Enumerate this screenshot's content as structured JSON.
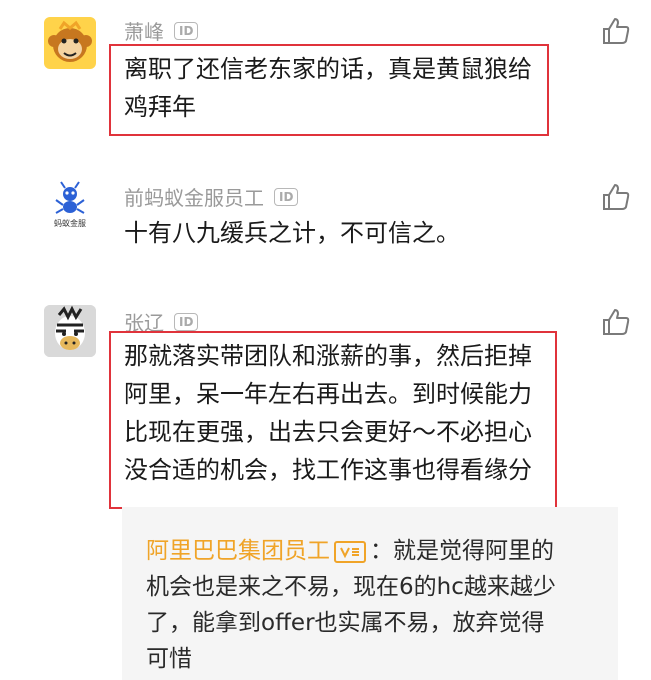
{
  "comments": [
    {
      "name": "萧峰",
      "badge": "ID",
      "lines": [
        "离职了还信老东家的话，真是黄鼠狼给",
        "鸡拜年"
      ]
    },
    {
      "name": "前蚂蚁金服员工",
      "badge": "ID",
      "avatar_text": "蚂蚁金服",
      "lines": [
        "十有八九缓兵之计，不可信之。"
      ]
    },
    {
      "name": "张辽",
      "badge": "ID",
      "lines": [
        "那就落实带团队和涨薪的事，然后拒掉",
        "阿里，呆一年左右再出去。到时候能力",
        "比现在更强，出去只会更好～不必担心",
        "没合适的机会，找工作这事也得看缘分"
      ]
    }
  ],
  "reply": {
    "name": "阿里巴巴集团员工",
    "separator": "：",
    "lines": [
      "就是觉得阿里的",
      "机会也是来之不易，现在6的hc越来越少",
      "了，能拿到offer也实属不易，放弃觉得",
      "可惜"
    ]
  },
  "colors": {
    "highlight": "#e0333b",
    "reply_name": "#f0a428",
    "name": "#9a9a9a"
  },
  "icons": {
    "like": "thumbs-up-icon",
    "badge": "id-badge-icon",
    "verified": "verified-badge-icon"
  }
}
